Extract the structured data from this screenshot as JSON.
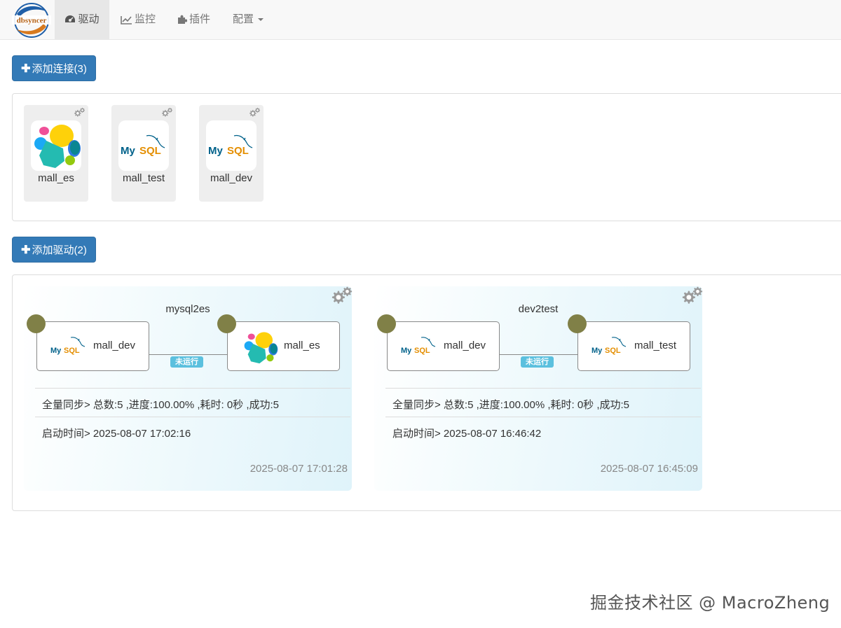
{
  "navbar": {
    "brand_text": "dbsyncer",
    "items": [
      {
        "label": "驱动",
        "icon": "dashboard-icon",
        "active": true
      },
      {
        "label": "监控",
        "icon": "line-chart-icon",
        "active": false
      },
      {
        "label": "插件",
        "icon": "puzzle-icon",
        "active": false
      },
      {
        "label": "配置",
        "icon": "",
        "active": false
      }
    ]
  },
  "connections": {
    "add_label": "添加连接(3)",
    "items": [
      {
        "name": "mall_es",
        "type": "elasticsearch"
      },
      {
        "name": "mall_test",
        "type": "mysql"
      },
      {
        "name": "mall_dev",
        "type": "mysql"
      }
    ]
  },
  "drivers": {
    "add_label": "添加驱动(2)",
    "items": [
      {
        "title": "mysql2es",
        "source": {
          "name": "mall_dev",
          "type": "mysql"
        },
        "target": {
          "name": "mall_es",
          "type": "elasticsearch"
        },
        "status": "未运行",
        "sync_info": "全量同步> 总数:5 ,进度:100.00% ,耗时: 0秒 ,成功:5",
        "start_time": "启动时间> 2025-08-07 17:02:16",
        "created": "2025-08-07 17:01:28"
      },
      {
        "title": "dev2test",
        "source": {
          "name": "mall_dev",
          "type": "mysql"
        },
        "target": {
          "name": "mall_test",
          "type": "mysql"
        },
        "status": "未运行",
        "sync_info": "全量同步> 总数:5 ,进度:100.00% ,耗时: 0秒 ,成功:5",
        "start_time": "启动时间> 2025-08-07 16:46:42",
        "created": "2025-08-07 16:45:09"
      }
    ]
  },
  "mysql_logo_text": {
    "my": "My",
    "sql": "SQL"
  },
  "watermark": "掘金技术社区 @ MacroZheng",
  "colors": {
    "primary": "#337ab7",
    "node_dot": "#808047",
    "badge": "#5bc0de",
    "mysql_blue": "#00618a",
    "mysql_orange": "#e48e00"
  }
}
